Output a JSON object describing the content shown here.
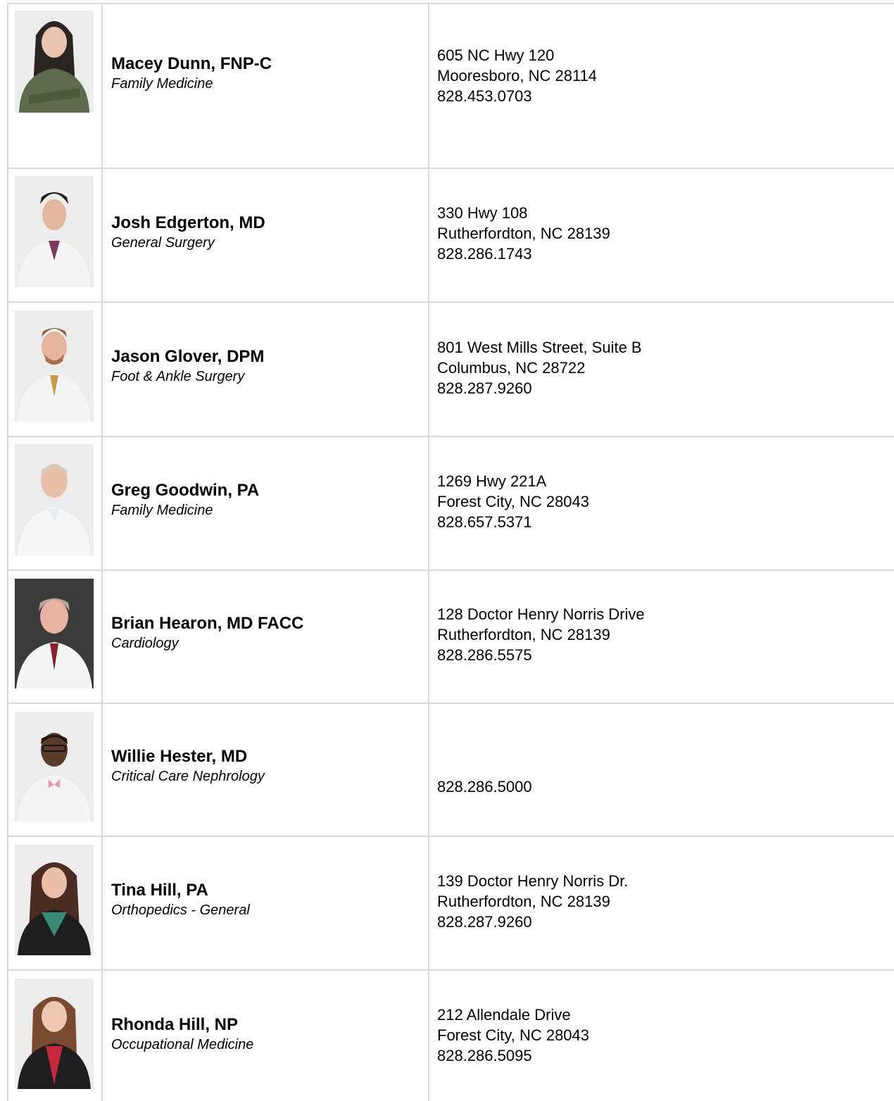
{
  "providers": [
    {
      "name": "Macey Dunn, FNP-C",
      "specialty": "Family Medicine",
      "address1": "605 NC Hwy 120",
      "address2": "Mooresboro, NC 28114",
      "phone": "828.453.0703",
      "photo": "photo-macey-dunn"
    },
    {
      "name": "Josh Edgerton, MD",
      "specialty": "General Surgery",
      "address1": "330 Hwy 108",
      "address2": "Rutherfordton, NC 28139",
      "phone": "828.286.1743",
      "photo": "photo-josh-edgerton"
    },
    {
      "name": "Jason Glover, DPM",
      "specialty": "Foot & Ankle Surgery",
      "address1": "801 West Mills Street, Suite B",
      "address2": "Columbus, NC 28722",
      "phone": "828.287.9260",
      "photo": "photo-jason-glover"
    },
    {
      "name": "Greg Goodwin, PA",
      "specialty": "Family Medicine",
      "address1": "1269 Hwy 221A",
      "address2": "Forest City, NC 28043",
      "phone": "828.657.5371",
      "photo": "photo-greg-goodwin"
    },
    {
      "name": "Brian Hearon, MD FACC",
      "specialty": "Cardiology",
      "address1": "128 Doctor Henry Norris Drive",
      "address2": "Rutherfordton, NC 28139",
      "phone": "828.286.5575",
      "photo": "photo-brian-hearon"
    },
    {
      "name": "Willie Hester, MD",
      "specialty": "Critical Care Nephrology",
      "address1": "",
      "address2": "",
      "phone": "828.286.5000",
      "photo": "photo-willie-hester"
    },
    {
      "name": "Tina Hill, PA",
      "specialty": "Orthopedics - General",
      "address1": "139 Doctor Henry Norris Dr.",
      "address2": "Rutherfordton, NC 28139",
      "phone": "828.287.9260",
      "photo": "photo-tina-hill"
    },
    {
      "name": "Rhonda Hill, NP",
      "specialty": "Occupational Medicine",
      "address1": "212 Allendale Drive",
      "address2": "Forest City, NC 28043",
      "phone": "828.286.5095",
      "photo": "photo-rhonda-hill"
    }
  ],
  "colors": {
    "border": "#d9d9d9",
    "text": "#000000",
    "photo_bg": "#e6e6e6"
  }
}
